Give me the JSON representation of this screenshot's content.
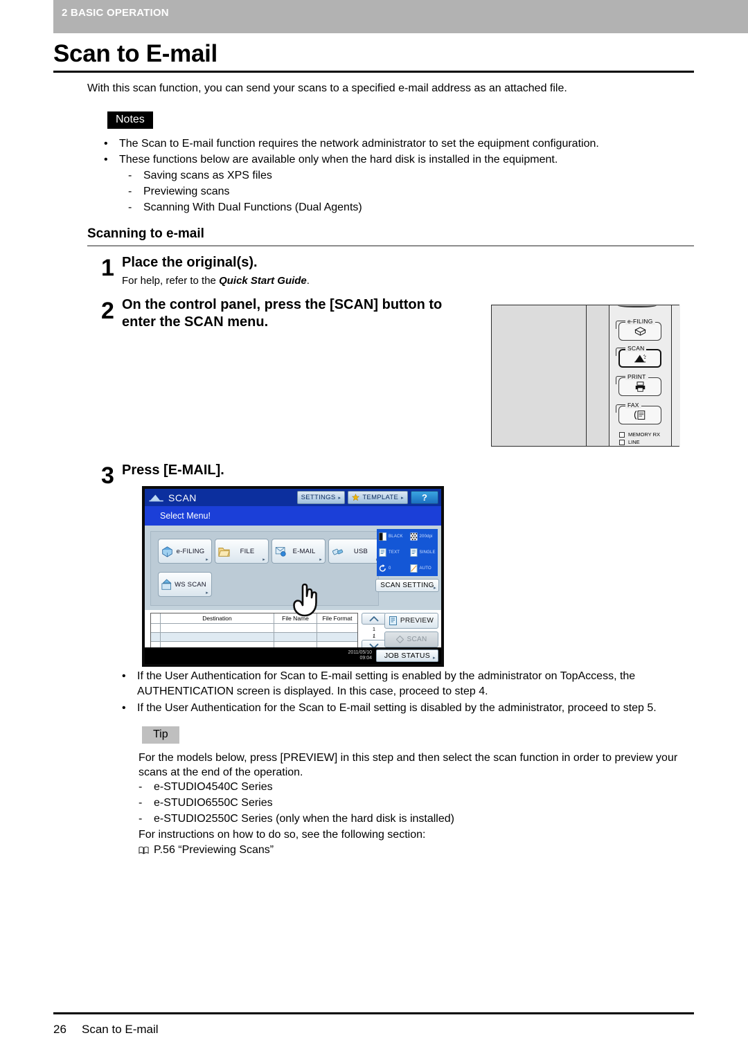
{
  "header": {
    "chapter": "2 BASIC OPERATION"
  },
  "page_title": "Scan to E-mail",
  "intro": "With this scan function, you can send your scans to a specified e-mail address as an attached file.",
  "notes": {
    "badge": "Notes",
    "bullets": [
      "The Scan to E-mail function requires the network administrator to set the equipment configuration.",
      "These functions below are available only when the hard disk is installed in the equipment."
    ],
    "subitems": [
      "Saving scans as XPS files",
      "Previewing scans",
      "Scanning With Dual Functions (Dual Agents)"
    ]
  },
  "section": {
    "heading": "Scanning to e-mail"
  },
  "steps": [
    {
      "number": "1",
      "title": "Place the original(s).",
      "sub_prefix": "For help, refer to the ",
      "sub_emphasis": "Quick Start Guide",
      "sub_suffix": "."
    },
    {
      "number": "2",
      "title": "On the control panel, press the [SCAN] button to enter the SCAN menu."
    },
    {
      "number": "3",
      "title": "Press [E-MAIL]."
    }
  ],
  "control_panel": {
    "keys": [
      {
        "label": "e-FILING",
        "icon": "efiling-icon",
        "selected": false
      },
      {
        "label": "SCAN",
        "icon": "scan-icon",
        "selected": true
      },
      {
        "label": "PRINT",
        "icon": "print-icon",
        "selected": false
      },
      {
        "label": "FAX",
        "icon": "fax-icon",
        "selected": false
      }
    ],
    "indicators": [
      "MEMORY RX",
      "LINE"
    ]
  },
  "scan_screen": {
    "title": "SCAN",
    "title_icon": "scanner-icon",
    "toolbar": [
      {
        "label": "SETTINGS",
        "icon": "none",
        "arrow": "▸"
      },
      {
        "label": "TEMPLATE",
        "icon": "star-icon",
        "arrow": "▸"
      }
    ],
    "help_label": "?",
    "message": "Select Menu!",
    "menu_buttons": [
      {
        "label": "e-FILING",
        "icon": "efiling-icon"
      },
      {
        "label": "FILE",
        "icon": "folder-icon"
      },
      {
        "label": "E-MAIL",
        "icon": "email-icon"
      },
      {
        "label": "USB",
        "icon": "usb-icon"
      },
      {
        "label": "WS SCAN",
        "icon": "wsscan-icon"
      }
    ],
    "cursor": "pointing-hand-cursor",
    "settings_grid": [
      {
        "label": "BLACK",
        "icon": "color-mode-icon"
      },
      {
        "label": "200dpi",
        "icon": "resolution-icon"
      },
      {
        "label": "TEXT",
        "icon": "original-mode-icon"
      },
      {
        "label": "SINGLE",
        "icon": "simplex-icon"
      },
      {
        "label": "0",
        "icon": "rotation-icon"
      },
      {
        "label": "AUTO",
        "icon": "original-size-icon"
      }
    ],
    "scan_setting_label": "SCAN SETTING",
    "table": {
      "columns": [
        "",
        "Destination",
        "File Name",
        "File Format"
      ],
      "rows": [
        [
          "",
          "",
          "",
          ""
        ],
        [
          "",
          "",
          "",
          ""
        ],
        [
          "",
          "",
          "",
          ""
        ]
      ]
    },
    "pager": {
      "up": "▲",
      "down": "▼",
      "current": "1",
      "total": "1"
    },
    "preview_label": "PREVIEW",
    "scan_label": "SCAN",
    "clock_date": "2011/05/10",
    "clock_time": "09:04",
    "job_status_label": "JOB STATUS"
  },
  "after_bullets": [
    "If the User Authentication for Scan to E-mail setting is enabled by the administrator on TopAccess, the AUTHENTICATION screen is displayed. In this case, proceed to step 4.",
    "If the User Authentication for the Scan to E-mail setting is disabled by the administrator, proceed to step 5."
  ],
  "tip": {
    "badge": "Tip",
    "intro": "For the models below, press [PREVIEW] in this step and then select the scan function in order to preview your scans at the end of the operation.",
    "models": [
      "e-STUDIO4540C Series",
      "e-STUDIO6550C Series",
      "e-STUDIO2550C Series (only when the hard disk is installed)"
    ],
    "outro": "For instructions on how to do so, see the following section:",
    "reference": "P.56 “Previewing Scans”"
  },
  "footer": {
    "page_number": "26",
    "title": "Scan to E-mail"
  }
}
